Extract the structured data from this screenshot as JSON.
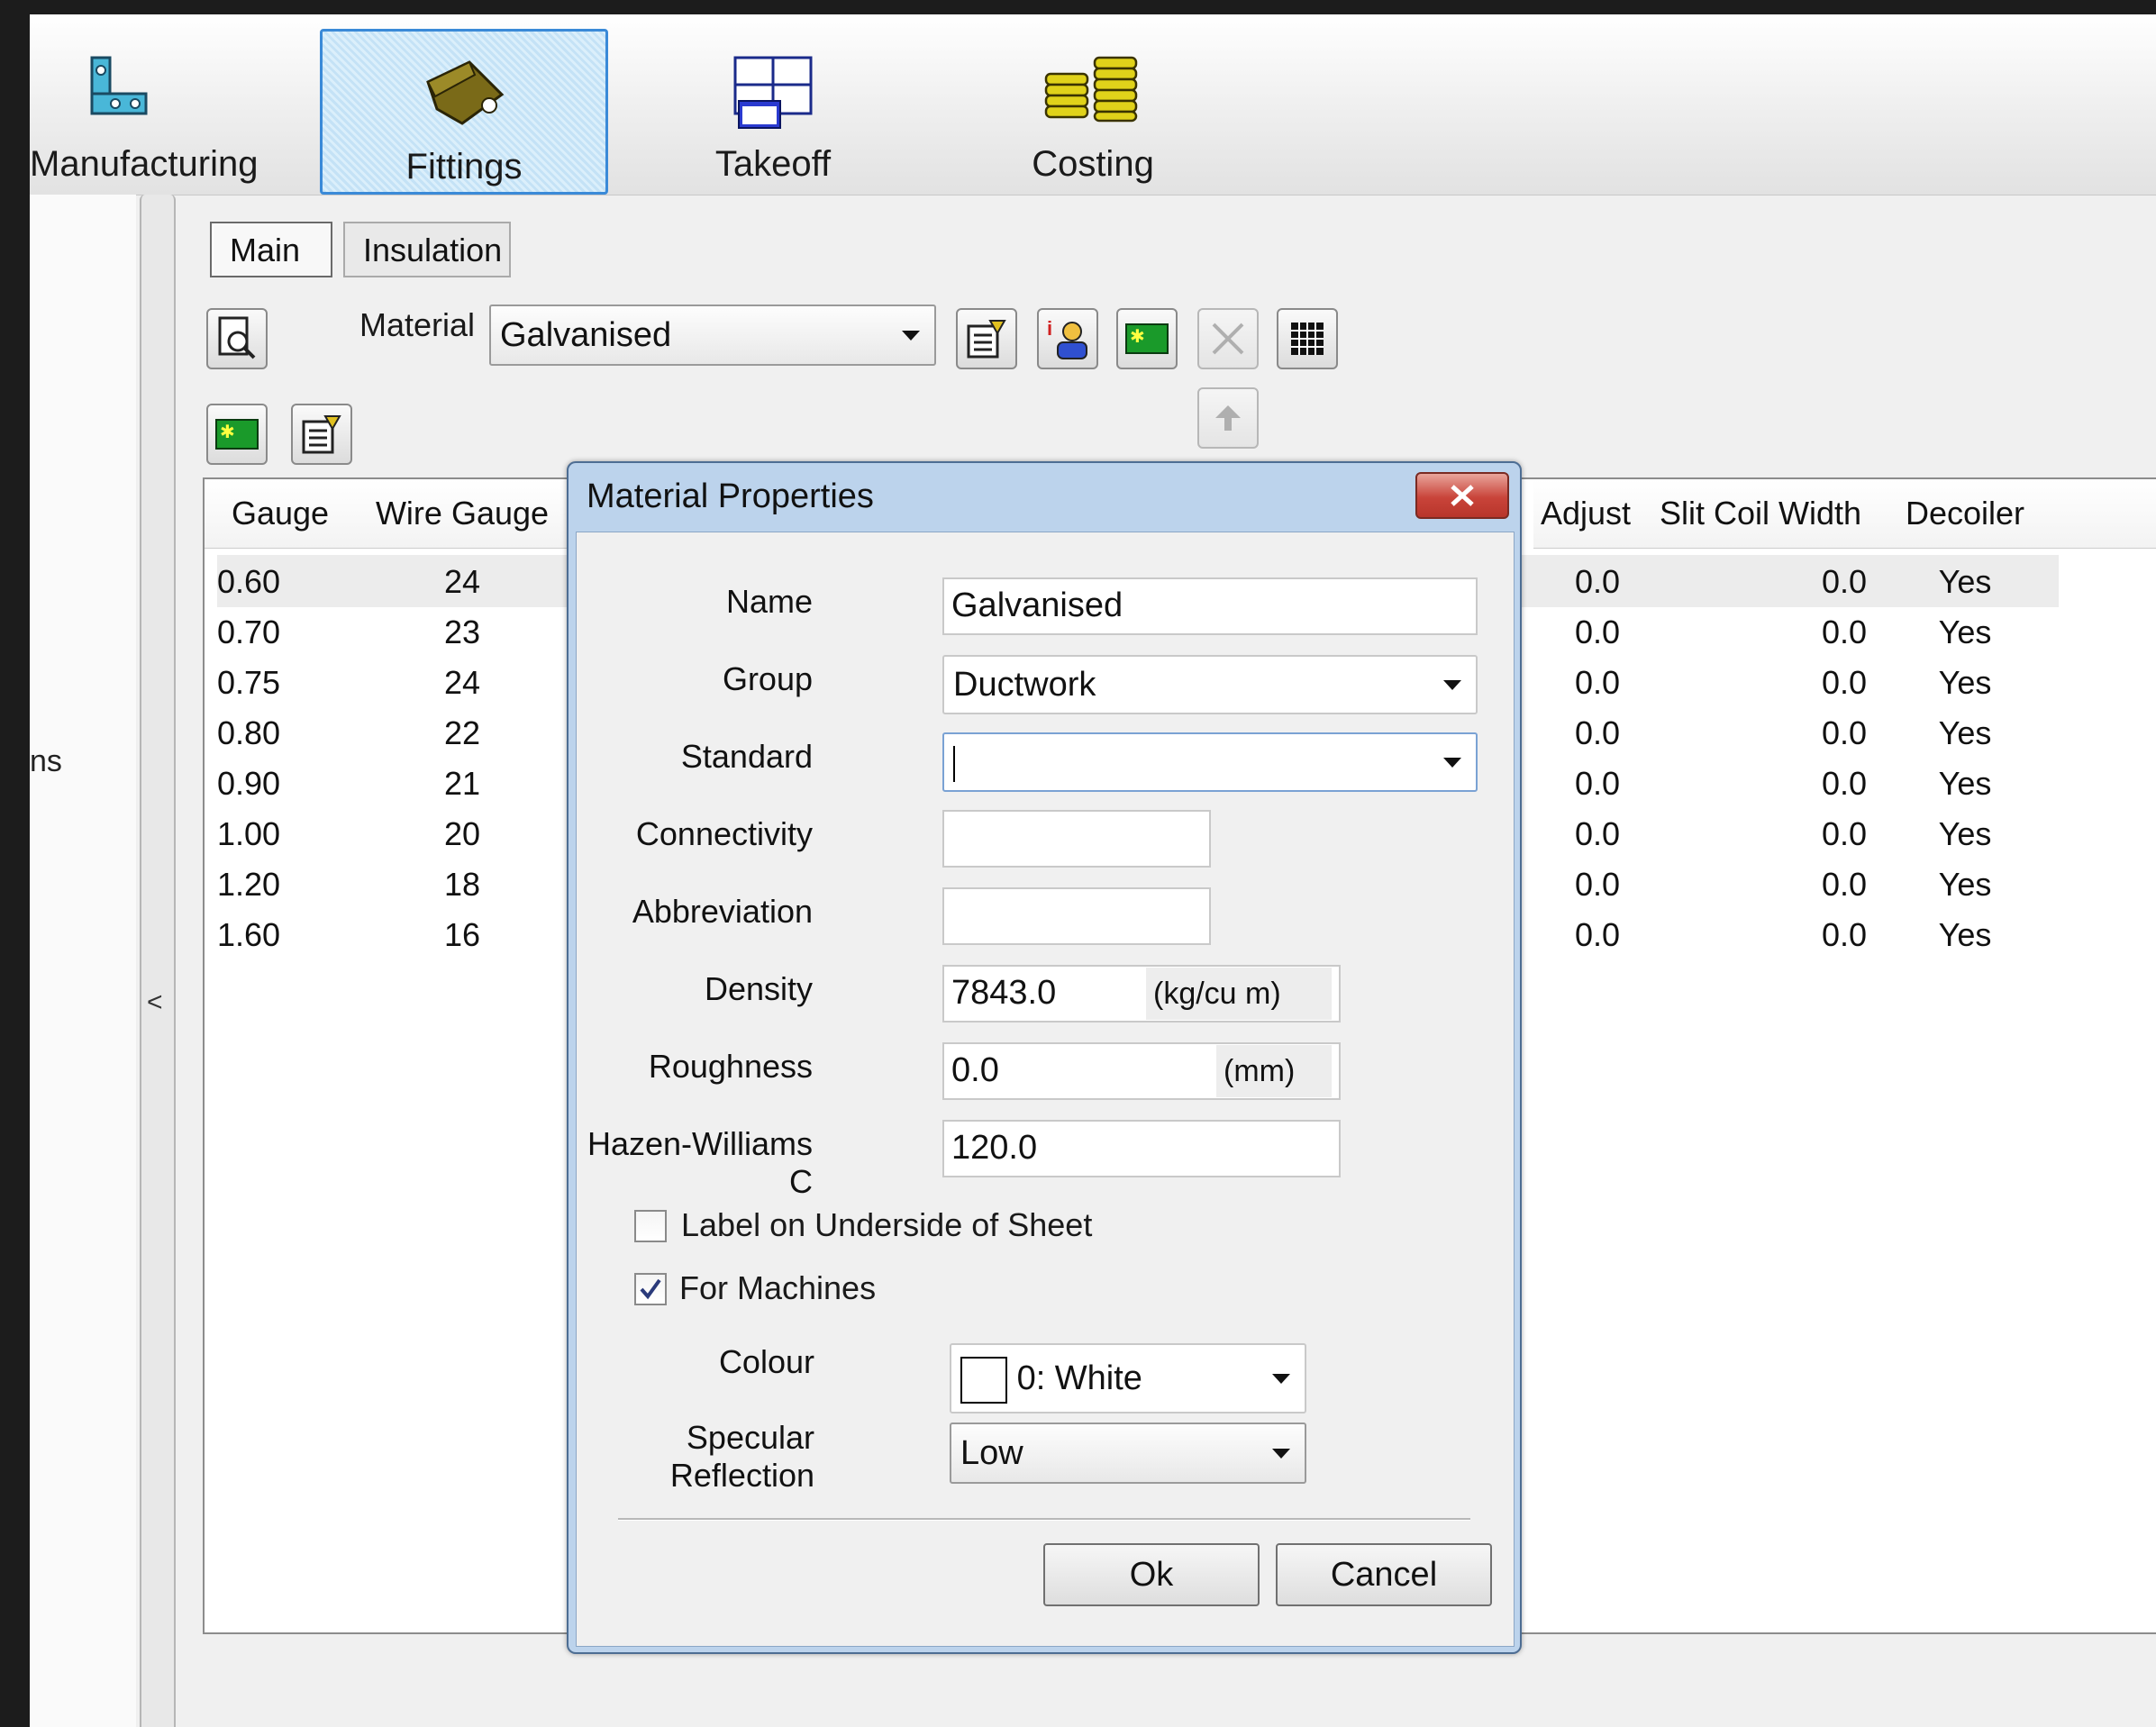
{
  "ribbon": {
    "buttons": [
      {
        "label": "Manufacturing",
        "icon": "manufacturing-icon"
      },
      {
        "label": "Fittings",
        "icon": "fittings-icon",
        "active": true
      },
      {
        "label": "Takeoff",
        "icon": "takeoff-icon"
      },
      {
        "label": "Costing",
        "icon": "costing-icon"
      }
    ]
  },
  "left_pane": {
    "truncated_text": "ns",
    "collapse_glyph": "<"
  },
  "tabs": {
    "main": "Main",
    "insulation": "Insulation"
  },
  "toolbar": {
    "material_label": "Material",
    "material_value": "Galvanised"
  },
  "grid": {
    "headers": {
      "gauge": "Gauge",
      "wire_gauge": "Wire Gauge",
      "adjust": "Adjust",
      "slit_coil_width": "Slit Coil Width",
      "decoiler": "Decoiler"
    },
    "rows": [
      {
        "gauge": "0.60",
        "wire": "24",
        "adjust": "0.0",
        "slit": "0.0",
        "decoiler": "Yes"
      },
      {
        "gauge": "0.70",
        "wire": "23",
        "adjust": "0.0",
        "slit": "0.0",
        "decoiler": "Yes"
      },
      {
        "gauge": "0.75",
        "wire": "24",
        "adjust": "0.0",
        "slit": "0.0",
        "decoiler": "Yes"
      },
      {
        "gauge": "0.80",
        "wire": "22",
        "adjust": "0.0",
        "slit": "0.0",
        "decoiler": "Yes"
      },
      {
        "gauge": "0.90",
        "wire": "21",
        "adjust": "0.0",
        "slit": "0.0",
        "decoiler": "Yes"
      },
      {
        "gauge": "1.00",
        "wire": "20",
        "adjust": "0.0",
        "slit": "0.0",
        "decoiler": "Yes"
      },
      {
        "gauge": "1.20",
        "wire": "18",
        "adjust": "0.0",
        "slit": "0.0",
        "decoiler": "Yes"
      },
      {
        "gauge": "1.60",
        "wire": "16",
        "adjust": "0.0",
        "slit": "0.0",
        "decoiler": "Yes"
      }
    ]
  },
  "dialog": {
    "title": "Material Properties",
    "fields": {
      "name_label": "Name",
      "name_value": "Galvanised",
      "group_label": "Group",
      "group_value": "Ductwork",
      "standard_label": "Standard",
      "standard_value": "",
      "connectivity_label": "Connectivity",
      "connectivity_value": "",
      "abbreviation_label": "Abbreviation",
      "abbreviation_value": "",
      "density_label": "Density",
      "density_value": "7843.0",
      "density_unit": "(kg/cu m)",
      "roughness_label": "Roughness",
      "roughness_value": "0.0",
      "roughness_unit": "(mm)",
      "hazen_label": "Hazen-Williams C",
      "hazen_value": "120.0",
      "label_underside": "Label on Underside of Sheet",
      "label_underside_checked": false,
      "for_machines": "For Machines",
      "for_machines_checked": true,
      "colour_label": "Colour",
      "colour_value": "0: White",
      "colour_swatch": "#ffffff",
      "specular_label": "Specular Reflection",
      "specular_value": "Low"
    },
    "ok": "Ok",
    "cancel": "Cancel"
  }
}
